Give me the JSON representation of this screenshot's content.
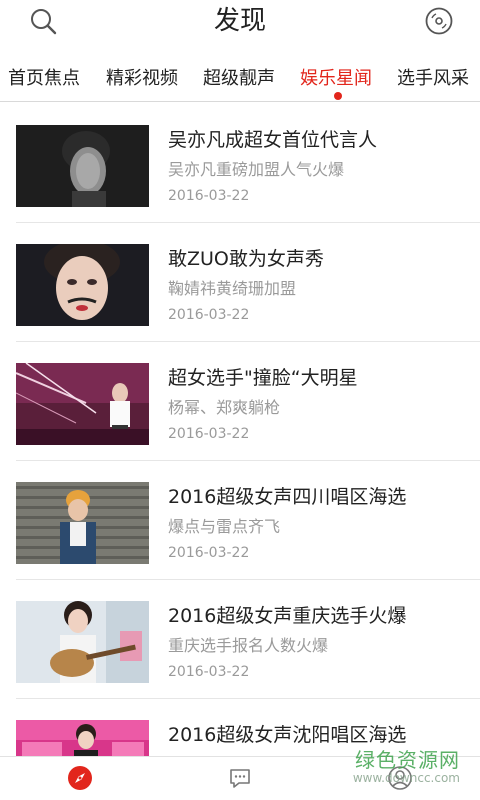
{
  "header": {
    "title": "发现",
    "left_icon": "search-icon",
    "right_icon": "disc-icon"
  },
  "tabs": [
    {
      "label": "首页焦点",
      "active": false
    },
    {
      "label": "精彩视频",
      "active": false
    },
    {
      "label": "超级靓声",
      "active": false
    },
    {
      "label": "娱乐星闻",
      "active": true
    },
    {
      "label": "选手风采",
      "active": false
    }
  ],
  "colors": {
    "accent": "#e2261c",
    "secondary_text": "#9a9a9a"
  },
  "articles": [
    {
      "title": "吴亦凡成超女首位代言人",
      "subtitle": "吴亦凡重磅加盟人气火爆",
      "date": "2016-03-22"
    },
    {
      "title": "敢ZUO敢为女声秀",
      "subtitle": "鞠婧祎黄绮珊加盟",
      "date": "2016-03-22"
    },
    {
      "title": "超女选手\"撞脸“大明星",
      "subtitle": "杨幂、郑爽躺枪",
      "date": "2016-03-22"
    },
    {
      "title": "2016超级女声四川唱区海选",
      "subtitle": "爆点与雷点齐飞",
      "date": "2016-03-22"
    },
    {
      "title": "2016超级女声重庆选手火爆",
      "subtitle": "重庆选手报名人数火爆",
      "date": "2016-03-22"
    },
    {
      "title": "2016超级女声沈阳唱区海选",
      "subtitle": "",
      "date": ""
    }
  ],
  "bottom_nav": [
    {
      "icon": "compass-icon"
    },
    {
      "icon": "chat-icon"
    },
    {
      "icon": "user-icon"
    }
  ],
  "watermark": {
    "line1": "绿色资源网",
    "line2": "www.downcc.com"
  }
}
